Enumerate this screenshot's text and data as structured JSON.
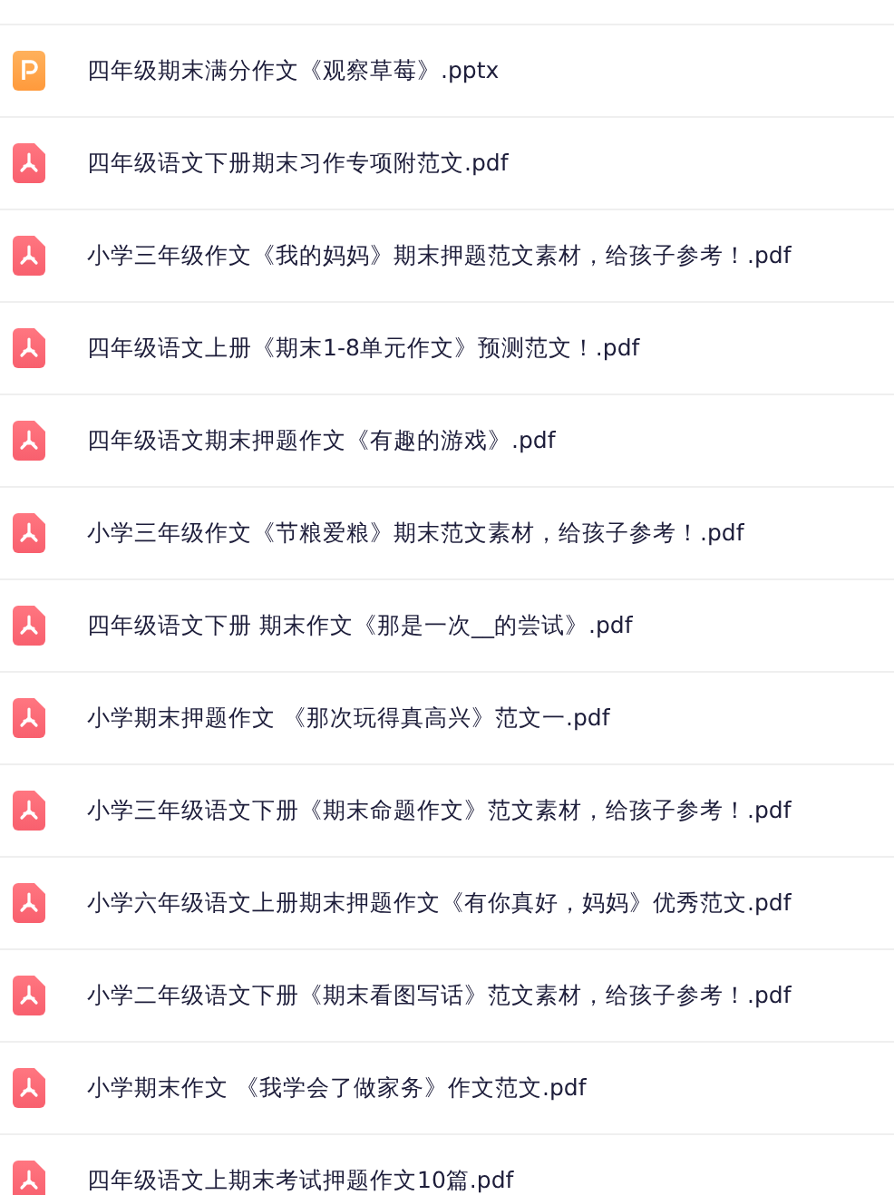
{
  "files": [
    {
      "kind": "pptx",
      "name": "四年级期末满分作文《观察草莓》.pptx"
    },
    {
      "kind": "pdf",
      "name": "四年级语文下册期末习作专项附范文.pdf"
    },
    {
      "kind": "pdf",
      "name": "小学三年级作文《我的妈妈》期末押题范文素材，给孩子参考！.pdf"
    },
    {
      "kind": "pdf",
      "name": "四年级语文上册《期末1-8单元作文》预测范文！.pdf"
    },
    {
      "kind": "pdf",
      "name": "四年级语文期末押题作文《有趣的游戏》.pdf"
    },
    {
      "kind": "pdf",
      "name": "小学三年级作文《节粮爱粮》期末范文素材，给孩子参考！.pdf"
    },
    {
      "kind": "pdf",
      "name": "四年级语文下册 期末作文《那是一次__的尝试》.pdf"
    },
    {
      "kind": "pdf",
      "name": "小学期末押题作文 《那次玩得真高兴》范文一.pdf"
    },
    {
      "kind": "pdf",
      "name": "小学三年级语文下册《期末命题作文》范文素材，给孩子参考！.pdf"
    },
    {
      "kind": "pdf",
      "name": "小学六年级语文上册期末押题作文《有你真好，妈妈》优秀范文.pdf"
    },
    {
      "kind": "pdf",
      "name": "小学二年级语文下册《期末看图写话》范文素材，给孩子参考！.pdf"
    },
    {
      "kind": "pdf",
      "name": "小学期末作文 《我学会了做家务》作文范文.pdf"
    },
    {
      "kind": "pdf",
      "name": "四年级语文上期末考试押题作文10篇.pdf"
    }
  ]
}
